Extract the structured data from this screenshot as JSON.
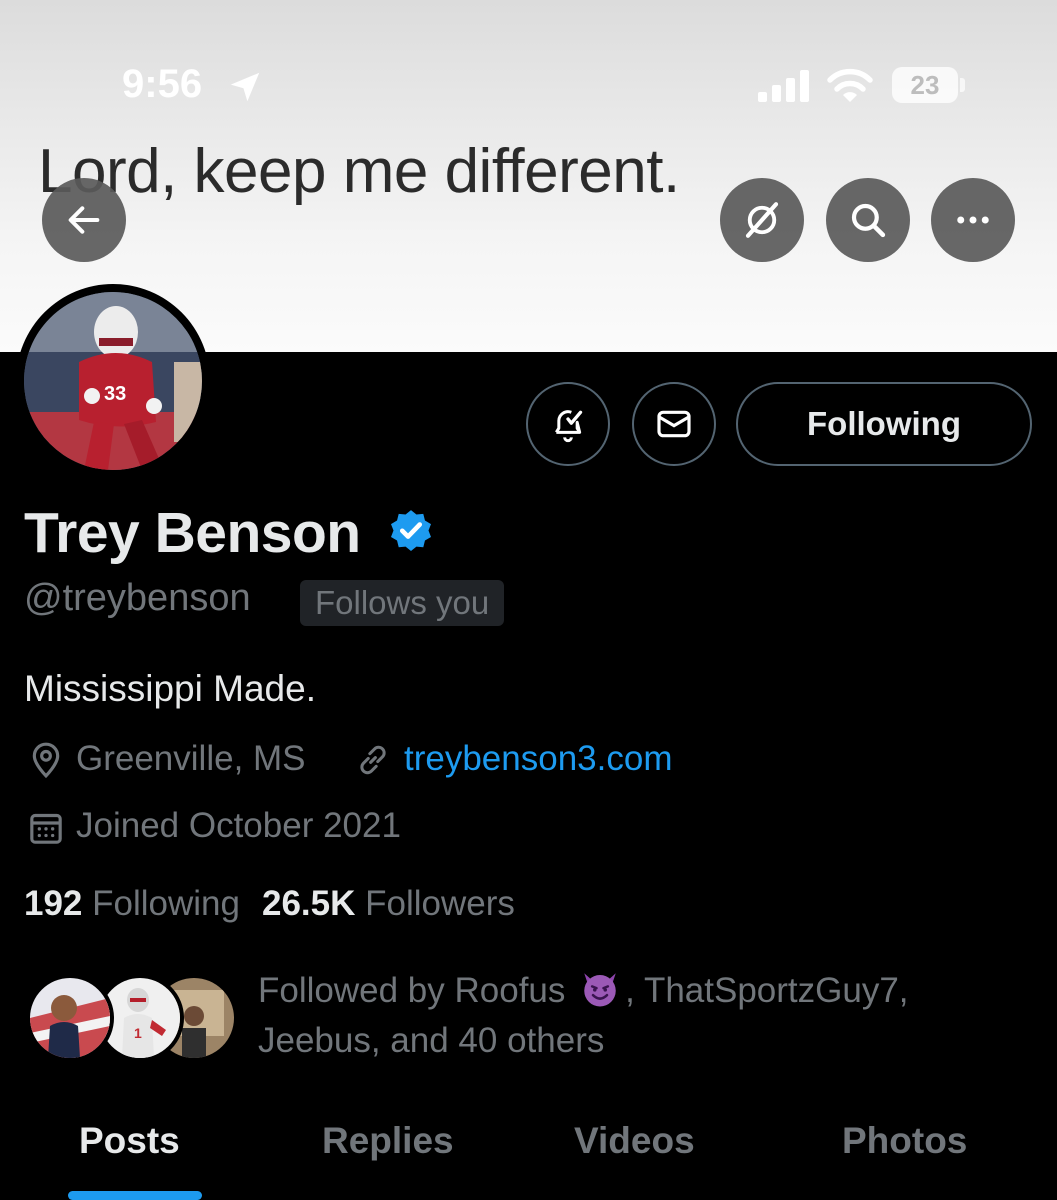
{
  "status_bar": {
    "time": "9:56",
    "battery": "23"
  },
  "banner": {
    "quote": "Lord, keep me different."
  },
  "profile": {
    "display_name": "Trey Benson",
    "handle": "@treybenson",
    "follows_you": "Follows you",
    "bio": "Mississippi Made.",
    "location": "Greenville, MS",
    "website": "treybenson3.com",
    "joined": "Joined October 2021",
    "following_count": "192",
    "following_label": "Following",
    "followers_count": "26.5K",
    "followers_label": "Followers"
  },
  "actions": {
    "following_button": "Following"
  },
  "followed_by": {
    "line1_prefix": "Followed by Roofus",
    "line1_suffix": ", ThatSportzGuy7,",
    "line2": "Jeebus, and 40 others"
  },
  "tabs": [
    {
      "label": "Posts",
      "active": true
    },
    {
      "label": "Replies"
    },
    {
      "label": "Videos"
    },
    {
      "label": "Photos"
    }
  ],
  "colors": {
    "accent": "#1d9bf0",
    "muted": "#71767b",
    "text": "#e7e9ea"
  },
  "icons": [
    "back-arrow-icon",
    "grok-icon",
    "search-icon",
    "more-icon",
    "notification-bell-icon",
    "message-icon",
    "verified-icon",
    "location-pin-icon",
    "link-icon",
    "calendar-icon",
    "smiling-devil-emoji"
  ]
}
